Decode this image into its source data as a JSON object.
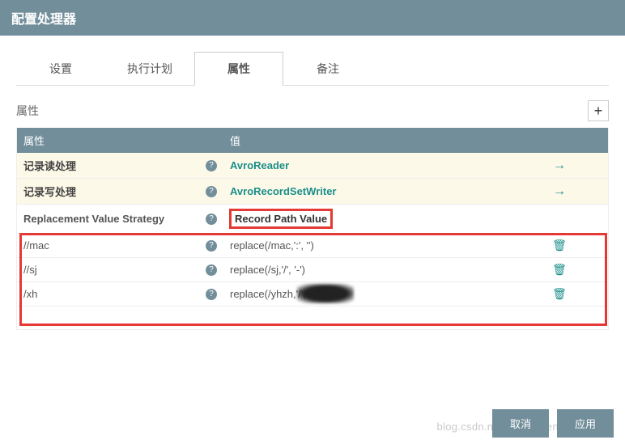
{
  "dialog": {
    "title": "配置处理器"
  },
  "tabs": [
    {
      "label": "设置",
      "active": false
    },
    {
      "label": "执行计划",
      "active": false
    },
    {
      "label": "属性",
      "active": true
    },
    {
      "label": "备注",
      "active": false
    }
  ],
  "section_header": "属性",
  "columns": {
    "name": "属性",
    "value": "值"
  },
  "rows": [
    {
      "name": "记录读处理",
      "value": "AvroReader",
      "link": true,
      "goto": true,
      "required": true
    },
    {
      "name": "记录写处理",
      "value": "AvroRecordSetWriter",
      "link": true,
      "goto": true,
      "required": true
    },
    {
      "name": "Replacement Value Strategy",
      "value": "Record Path Value",
      "bold": true,
      "highlight_value": true,
      "required": false
    },
    {
      "name": "//mac",
      "value": "replace(/mac,':', '')",
      "trash": true
    },
    {
      "name": "//sj",
      "value": "replace(/sj,'/', '-')",
      "trash": true
    },
    {
      "name": "/xh",
      "value": "replace(/yhzh,'/', '')",
      "trash": true,
      "smudge": true
    }
  ],
  "buttons": {
    "cancel": "取消",
    "apply": "应用"
  },
  "watermark": "blog.csdn.net/liuyunshengsir"
}
